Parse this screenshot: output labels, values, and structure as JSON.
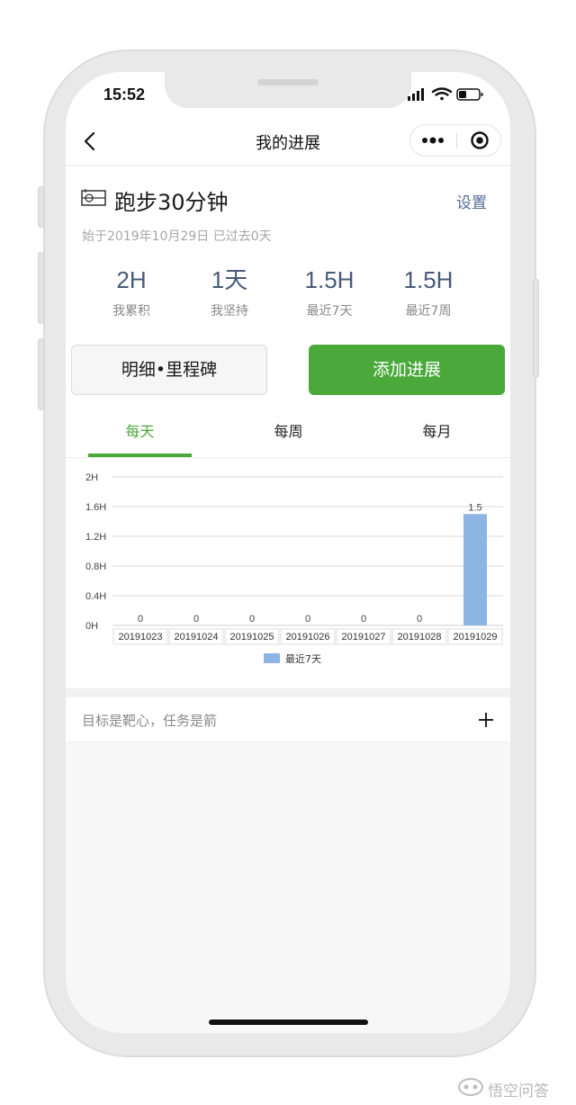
{
  "status_bar": {
    "time": "15:52"
  },
  "nav": {
    "title": "我的进展"
  },
  "goal": {
    "title": "跑步30分钟",
    "settings_label": "设置",
    "meta": "始于2019年10月29日 已过去0天"
  },
  "stats": [
    {
      "value": "2H",
      "label": "我累积"
    },
    {
      "value": "1天",
      "label": "我坚持"
    },
    {
      "value": "1.5H",
      "label": "最近7天"
    },
    {
      "value": "1.5H",
      "label": "最近7周"
    }
  ],
  "buttons": {
    "detail_label": "明细•里程碑",
    "add_label": "添加进展"
  },
  "tabs": [
    {
      "label": "每天",
      "active": true
    },
    {
      "label": "每周",
      "active": false
    },
    {
      "label": "每月",
      "active": false
    }
  ],
  "chart_data": {
    "type": "bar",
    "categories": [
      "20191023",
      "20191024",
      "20191025",
      "20191026",
      "20191027",
      "20191028",
      "20191029"
    ],
    "series": [
      {
        "name": "最近7天",
        "values": [
          0,
          0,
          0,
          0,
          0,
          0,
          1.5
        ],
        "color": "#8cb5e4"
      }
    ],
    "data_labels": [
      "0",
      "0",
      "0",
      "0",
      "0",
      "0",
      "1.5"
    ],
    "y_ticks": [
      {
        "value": 0,
        "label": "0H"
      },
      {
        "value": 0.4,
        "label": "0.4H"
      },
      {
        "value": 0.8,
        "label": "0.8H"
      },
      {
        "value": 1.2,
        "label": "1.2H"
      },
      {
        "value": 1.6,
        "label": "1.6H"
      },
      {
        "value": 2,
        "label": "2H"
      }
    ],
    "ylim": [
      0,
      2
    ],
    "grid": true,
    "legend": "bottom-center"
  },
  "motto": {
    "text": "目标是靶心，任务是箭"
  },
  "watermark": {
    "text": "悟空问答"
  },
  "colors": {
    "accent": "#4aa93a",
    "link": "#576b95",
    "stat_value": "#4a5a7a"
  }
}
